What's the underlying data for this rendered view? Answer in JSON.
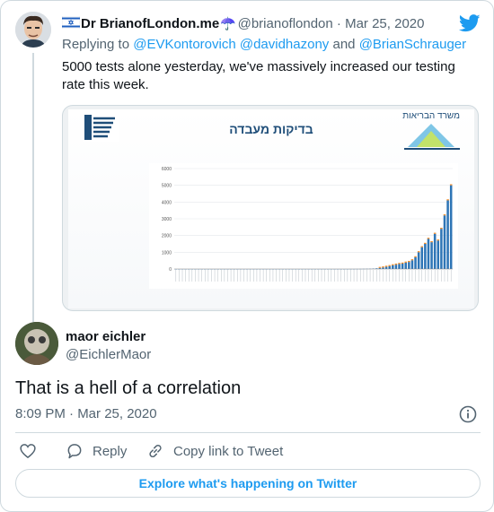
{
  "parent_tweet": {
    "display_name": "Dr BrianofLondon.me",
    "handle": "@brianoflondon",
    "separator": "·",
    "date": "Mar 25, 2020",
    "reply_prefix": "Replying to",
    "reply_mentions": [
      "@EVKontorovich",
      "@davidhazony",
      "@BrianSchrauger"
    ],
    "reply_joiner": "and",
    "text_line_1": "5000 tests alone yesterday, we've massively increased our testing",
    "text_line_2": "rate this week.",
    "media": {
      "slide_title": "בדיקות מעבדה",
      "ministry": "משרד הבריאות",
      "chart_data": {
        "type": "bar",
        "series": [
          {
            "values": [
              0,
              0,
              0,
              0,
              0,
              0,
              0,
              0,
              0,
              0,
              0,
              0,
              0,
              0,
              0,
              0,
              0,
              0,
              0,
              0,
              0,
              0,
              0,
              0,
              0,
              0,
              0,
              0,
              0,
              0,
              0,
              0,
              0,
              0,
              0,
              0,
              0,
              0,
              0,
              0,
              0,
              0,
              0,
              0,
              0,
              0,
              0,
              0,
              0,
              0,
              0,
              0,
              0,
              0,
              2,
              2,
              4,
              6,
              9,
              12,
              15,
              25,
              40,
              60,
              90,
              130,
              170,
              220,
              260,
              300,
              320,
              380,
              420,
              520,
              700,
              1000,
              1300,
              1500,
              1800,
              1600,
              2100,
              1700,
              2400,
              3200,
              4100,
              5000
            ]
          }
        ],
        "ylim": [
          0,
          6000
        ],
        "yticks": [
          0,
          1000,
          2000,
          3000,
          4000,
          5000,
          6000
        ],
        "grid": true,
        "colors": {
          "bar": "#2e75b6",
          "bar_top": "#f08a24"
        }
      }
    }
  },
  "reply_tweet": {
    "display_name": "maor eichler",
    "handle": "@EichlerMaor",
    "text": "That is a hell of a correlation",
    "time": "8:09 PM · Mar 25, 2020"
  },
  "actions": {
    "reply_label": "Reply",
    "copy_label": "Copy link to Tweet"
  },
  "explore_label": "Explore what's happening on Twitter",
  "colors": {
    "accent": "#1d9bf0",
    "muted": "#536471",
    "border": "#cfd9de",
    "text": "#0f1419"
  }
}
